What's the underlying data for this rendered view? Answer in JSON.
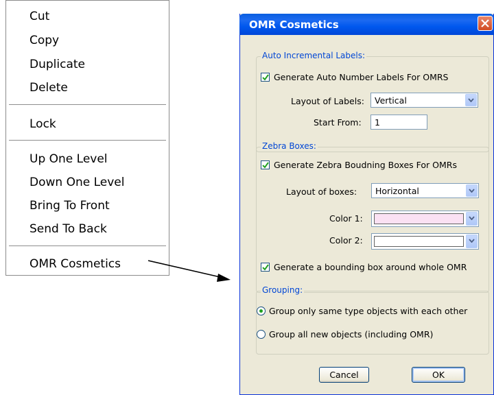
{
  "context_menu": {
    "items": [
      "Cut",
      "Copy",
      "Duplicate",
      "Delete",
      "Lock",
      "Up One Level",
      "Down One Level",
      "Bring To Front",
      "Send To Back",
      "OMR Cosmetics"
    ]
  },
  "dialog": {
    "title": "OMR Cosmetics",
    "auto_labels": {
      "legend": "Auto Incremental Labels:",
      "generate_label": "Generate Auto Number Labels For OMRS",
      "generate_checked": true,
      "layout_label": "Layout of Labels:",
      "layout_value": "Vertical",
      "start_label": "Start From:",
      "start_value": "1"
    },
    "zebra": {
      "legend": "Zebra Boxes:",
      "generate_label": "Generate Zebra Boudning Boxes For OMRs",
      "generate_checked": true,
      "layout_label": "Layout of boxes:",
      "layout_value": "Horizontal",
      "color1_label": "Color 1:",
      "color1_value": "#fbe1f3",
      "color2_label": "Color 2:",
      "color2_value": "#ffffff",
      "bounding_label": "Generate a bounding box around whole OMR",
      "bounding_checked": true
    },
    "grouping": {
      "legend": "Grouping:",
      "option1": "Group only same type objects with each other",
      "option2": "Group all new objects (including OMR)",
      "selected": 1
    },
    "buttons": {
      "cancel": "Cancel",
      "ok": "OK"
    }
  },
  "colors": {
    "legend_text": "#0046d5",
    "title_bar": "#0058ee",
    "check_green": "#21a121"
  }
}
